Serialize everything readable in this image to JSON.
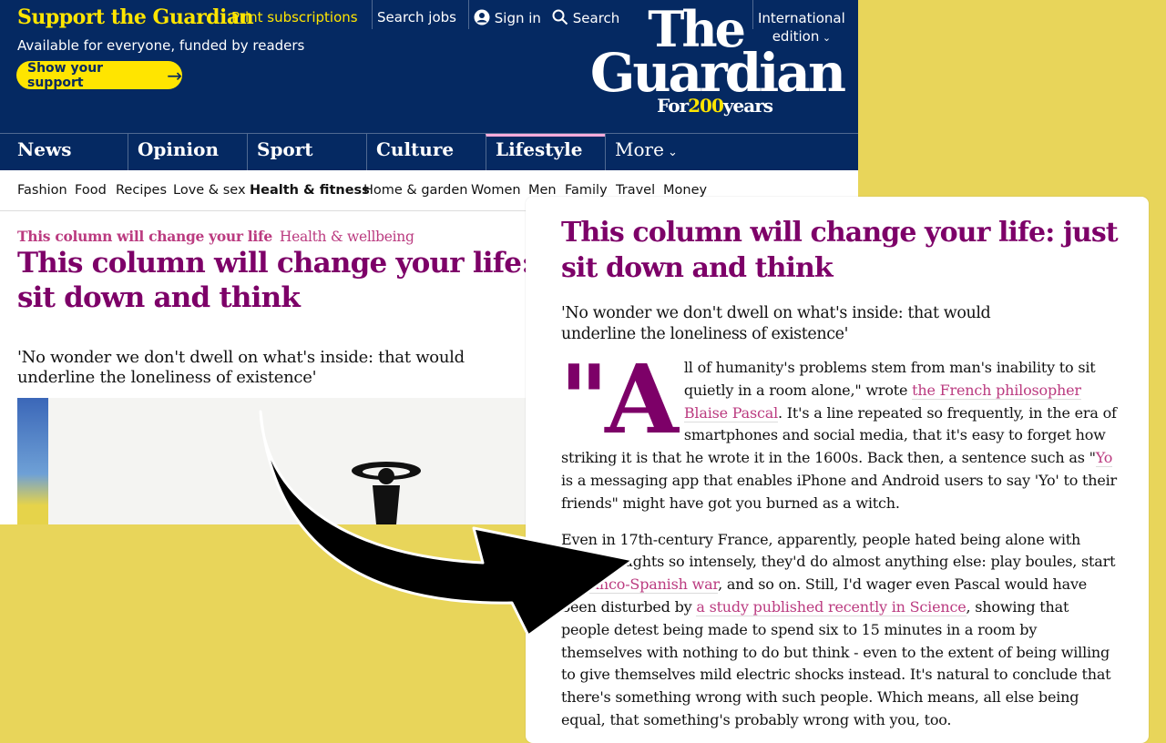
{
  "header": {
    "support_title": "Support the Guardian",
    "support_subtitle": "Available for everyone, funded by readers",
    "support_button": "Show your support",
    "print_subscriptions": "Print subscriptions",
    "search_jobs": "Search jobs",
    "sign_in": "Sign in",
    "search": "Search",
    "edition_line1": "International",
    "edition_line2": "edition",
    "logo_the": "The",
    "logo_guardian": "Guardian",
    "logo_for": "For",
    "logo_200": "200",
    "logo_years": "years"
  },
  "pillars": [
    "News",
    "Opinion",
    "Sport",
    "Culture",
    "Lifestyle",
    "More"
  ],
  "subnav": [
    "Fashion",
    "Food",
    "Recipes",
    "Love & sex",
    "Health & fitness",
    "Home & garden",
    "Women",
    "Men",
    "Family",
    "Travel",
    "Money"
  ],
  "article_bg": {
    "series": "This column will change your life",
    "section": "Health & wellbeing",
    "headline_line1": "This column will change your life: ju",
    "headline_line2": "sit down and think",
    "standfirst": "'No wonder we don't dwell on what's inside: that would underline the loneliness of existence'"
  },
  "reader_view": {
    "headline": "This column will change your life: just sit down and think",
    "standfirst": "'No wonder we don't dwell on what's inside: that would underline the loneliness of existence'",
    "dropcap": "\"A",
    "p1_a": "ll of humanity's problems stem from man's inability to sit quietly in a room alone,\" wrote ",
    "p1_link1": "the French philosopher Blaise Pascal",
    "p1_b": ". It's a line repeated so frequently, in the era of smartphones and social media, that it's easy to forget how striking it is that he wrote it in the 1600s. Back then, a sentence such as \"",
    "p1_link2": "Yo",
    "p1_c": " is a messaging app that enables iPhone and Android users to say 'Yo' to their friends\" might have got you burned as a witch.",
    "p2_a": "Even in 17th-century France, apparently, people hated being alone with their thoughts so intensely, they'd do almost anything else: play boules, start a ",
    "p2_link1": "Franco-Spanish war",
    "p2_b": ", and so on. Still, I'd wager even Pascal would have been disturbed by ",
    "p2_link2": "a study published recently in Science",
    "p2_c": ", showing that people detest being made to spend six to 15 minutes in a room by themselves with nothing to do but think - even to the extent of being willing to give themselves mild electric shocks instead. It's natural to conclude that there's something wrong with such people. Which means, all else being equal, that something's probably wrong with you, too."
  },
  "colors": {
    "background": "#e8d55a",
    "brand_blue": "#052962",
    "brand_yellow": "#ffe500",
    "lifestyle_purple": "#7d0068",
    "link_pink": "#bb3b80"
  }
}
